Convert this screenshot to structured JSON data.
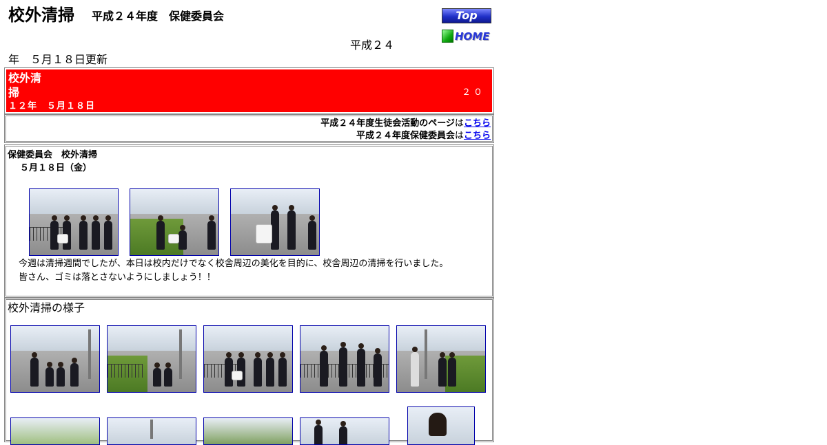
{
  "header": {
    "title": "校外清掃",
    "subtitle": "平成２４年度　保健委員会",
    "top_button": "Top",
    "home_button": "HOME"
  },
  "update": {
    "part1": "平成２４",
    "part2": "年　５月１８日更新"
  },
  "banner": {
    "title_line1": "校外清",
    "title_line2": "掃",
    "date": "１２年　５月１８日",
    "number": "２０",
    "color": "#ff0000"
  },
  "links": [
    {
      "label": "平成２４年度生徒会活動のページ",
      "ha": "は",
      "link": "こちら"
    },
    {
      "label": "平成２４年度保健委員会",
      "ha": "は",
      "link": "こちら"
    }
  ],
  "report": {
    "title": "保健委員会　校外清掃",
    "date": "５月１８日（金）",
    "text1": "今週は清掃週間でしたが、本日は校内だけでなく校舎周辺の美化を目的に、校舎周辺の清掃を行いました。",
    "text2": "皆さん、ゴミは落とさないようにしましょう！！"
  },
  "gallery": {
    "title": "校外清掃の様子"
  },
  "colors": {
    "link": "#0000ee",
    "photo_border": "#0000aa"
  }
}
